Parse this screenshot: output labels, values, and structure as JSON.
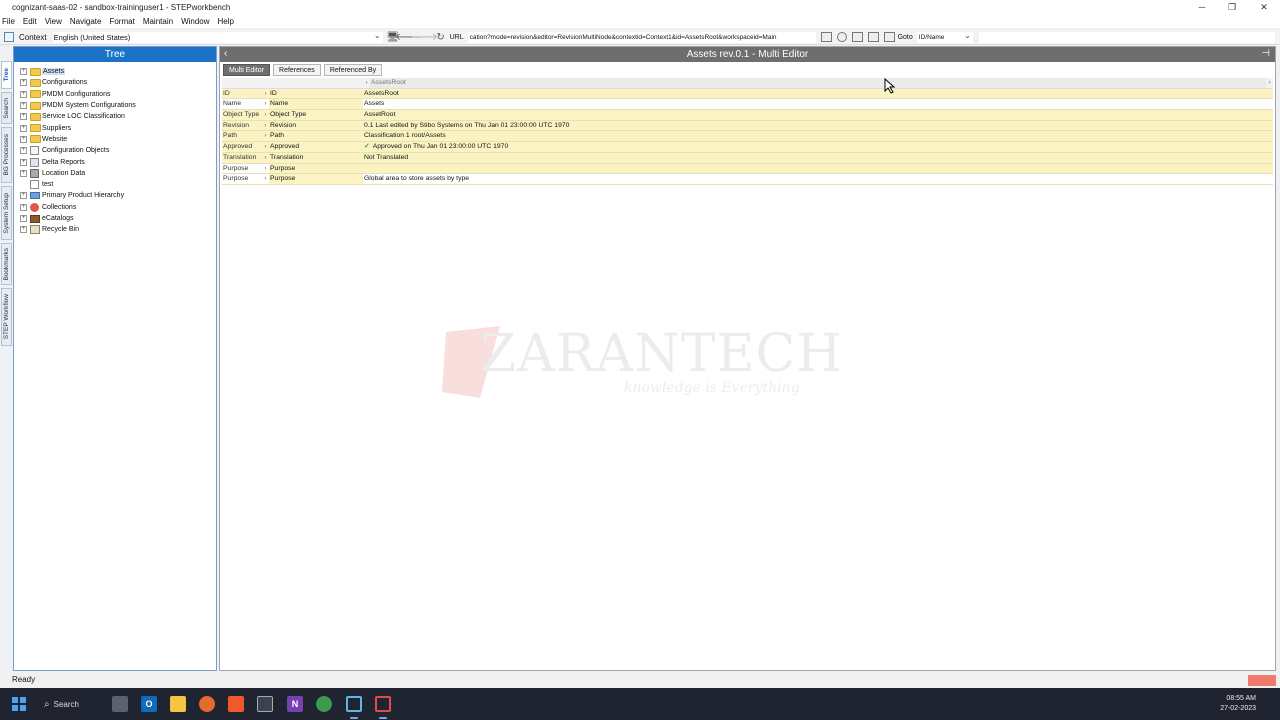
{
  "window": {
    "title": "cognizant-saas-02 - sandbox-traininguser1 - STEPworkbench",
    "controls": [
      "─",
      "❐",
      "✕"
    ]
  },
  "menu": [
    "File",
    "Edit",
    "View",
    "Navigate",
    "Format",
    "Maintain",
    "Window",
    "Help"
  ],
  "toolbar": {
    "context_label": "Context",
    "context_value": "English (United States)",
    "url_label": "URL",
    "url_value": "cation?mode=revision&editor=RevisionMultiNode&contextid=Context1&id=AssetsRoot&workspaceid=Main",
    "goto_label": "Goto",
    "goto_value": "ID/Name",
    "goto_input": ""
  },
  "side_tabs": [
    "Tree",
    "Search",
    "BG Processes",
    "System Setup",
    "Bookmarks",
    "STEP Workflow"
  ],
  "tree": {
    "header": "Tree",
    "items": [
      {
        "label": "Assets",
        "icon": "folder-icon",
        "selected": true
      },
      {
        "label": "Configurations",
        "icon": "folder-icon"
      },
      {
        "label": "PMDM Configurations",
        "icon": "folder-icon"
      },
      {
        "label": "PMDM System Configurations",
        "icon": "folder-icon"
      },
      {
        "label": "Service LOC Classification",
        "icon": "folder-icon"
      },
      {
        "label": "Suppliers",
        "icon": "folder-icon"
      },
      {
        "label": "Website",
        "icon": "folder-icon"
      },
      {
        "label": "Configuration Objects",
        "icon": "config-objects-icon"
      },
      {
        "label": "Delta Reports",
        "icon": "delta-reports-icon"
      },
      {
        "label": "Location Data",
        "icon": "location-data-icon"
      },
      {
        "label": "test",
        "icon": "test-icon"
      },
      {
        "label": "Primary Product Hierarchy",
        "icon": "product-hierarchy-icon"
      },
      {
        "label": "Collections",
        "icon": "collections-icon"
      },
      {
        "label": "eCatalogs",
        "icon": "ecatalogs-icon"
      },
      {
        "label": "Recycle Bin",
        "icon": "recycle-bin-icon"
      }
    ]
  },
  "editor": {
    "title": "Assets rev.0.1 - Multi Editor",
    "tabs": [
      "Multi Editor",
      "References",
      "Referenced By"
    ],
    "column_header": "AssetsRoot",
    "rows": [
      {
        "col1": "ID",
        "col2": "ID",
        "value": "AssetsRoot"
      },
      {
        "col1": "Name",
        "col2": "Name",
        "value": "Assets"
      },
      {
        "col1": "Object Type",
        "col2": "Object Type",
        "value": "AssetRoot"
      },
      {
        "col1": "Revision",
        "col2": "Revision",
        "value": "0.1 Last edited by Stibo Systems on Thu Jan 01 23:00:00 UTC 1970"
      },
      {
        "col1": "Path",
        "col2": "Path",
        "value": "Classification 1 root/Assets"
      },
      {
        "col1": "Approved",
        "col2": "Approved",
        "value": "Approved on Thu Jan 01 23:00:00 UTC 1970"
      },
      {
        "col1": "Translation",
        "col2": "Translation",
        "value": "Not Translated"
      },
      {
        "col1": "Purpose",
        "col2": "Purpose",
        "value": ""
      },
      {
        "col1": "Purpose",
        "col2": "Purpose",
        "value": "Global area to store assets by type"
      }
    ]
  },
  "watermark": {
    "text": "ZARANTECH",
    "tagline": "knowledge is Everything"
  },
  "status": {
    "text": "Ready"
  },
  "taskbar": {
    "search_label": "Search",
    "time": "08:55 AM",
    "date": "27-02-2023"
  }
}
